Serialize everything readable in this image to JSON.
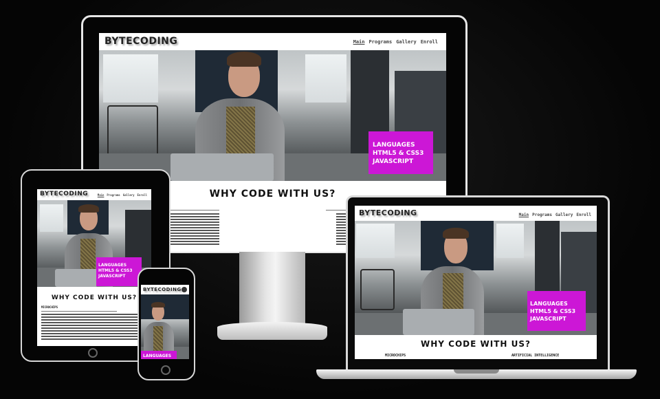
{
  "site": {
    "brand": "BYTECODING",
    "nav": [
      "Main",
      "Programs",
      "Gallery",
      "Enroll"
    ],
    "active_nav": "Main",
    "hero_promo": [
      "LANGUAGES",
      "HTML5 & CSS3",
      "JAVASCRIPT"
    ],
    "section_title": "WHY CODE WITH US?",
    "columns": [
      "MICROCHIPS",
      "ARTIFICIAL INTELLIGENCE"
    ]
  },
  "colors": {
    "promo": "#cc17d6",
    "background": "#050505"
  }
}
